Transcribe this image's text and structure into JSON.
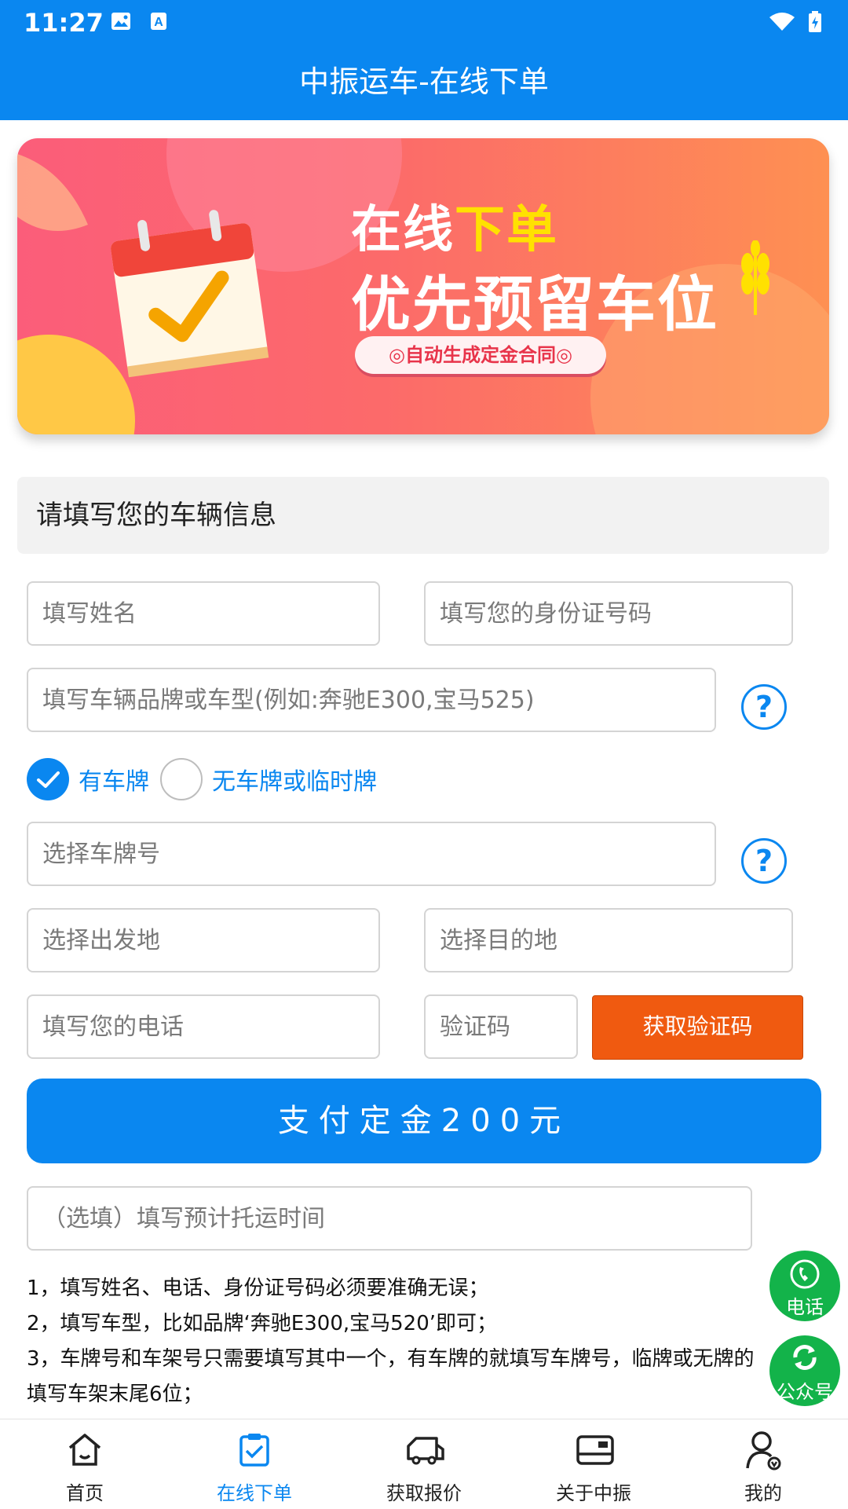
{
  "status_bar": {
    "time": "11:27"
  },
  "app_bar": {
    "title": "中振运车-在线下单"
  },
  "banner": {
    "headline_part1": "在线",
    "headline_part2": "下单",
    "subheadline": "优先预留车位",
    "badge": "◎自动生成定金合同◎"
  },
  "form": {
    "section_title": "请填写您的车辆信息",
    "name_placeholder": "填写姓名",
    "id_placeholder": "填写您的身份证号码",
    "car_model_placeholder": "填写车辆品牌或车型(例如:奔驰E300,宝马525)",
    "plate_option_yes": "有车牌",
    "plate_option_no": "无车牌或临时牌",
    "plate_placeholder": "选择车牌号",
    "origin_placeholder": "选择出发地",
    "destination_placeholder": "选择目的地",
    "phone_placeholder": "填写您的电话",
    "code_placeholder": "验证码",
    "get_code_label": "获取验证码",
    "pay_label": "支付定金200元",
    "ship_time_placeholder": "（选填）填写预计托运时间",
    "help_symbol": "?"
  },
  "notes": [
    "1，填写姓名、电话、身份证号码必须要准确无误；",
    "2，填写车型，比如品牌‘奔驰E300,宝马520’即可；",
    "3，车牌号和车架号只需要填写其中一个，有车牌的就填写车牌号，临牌或无牌的",
    "填写车架末尾6位；"
  ],
  "floating": {
    "phone_label": "电话",
    "wechat_label": "公众号"
  },
  "tabs": [
    {
      "label": "首页",
      "icon": "home-icon"
    },
    {
      "label": "在线下单",
      "icon": "order-icon"
    },
    {
      "label": "获取报价",
      "icon": "truck-icon"
    },
    {
      "label": "关于中振",
      "icon": "card-icon"
    },
    {
      "label": "我的",
      "icon": "user-icon"
    }
  ],
  "colors": {
    "primary": "#0a87f0",
    "code_button": "#f05a10",
    "float_button": "#13b34a"
  }
}
